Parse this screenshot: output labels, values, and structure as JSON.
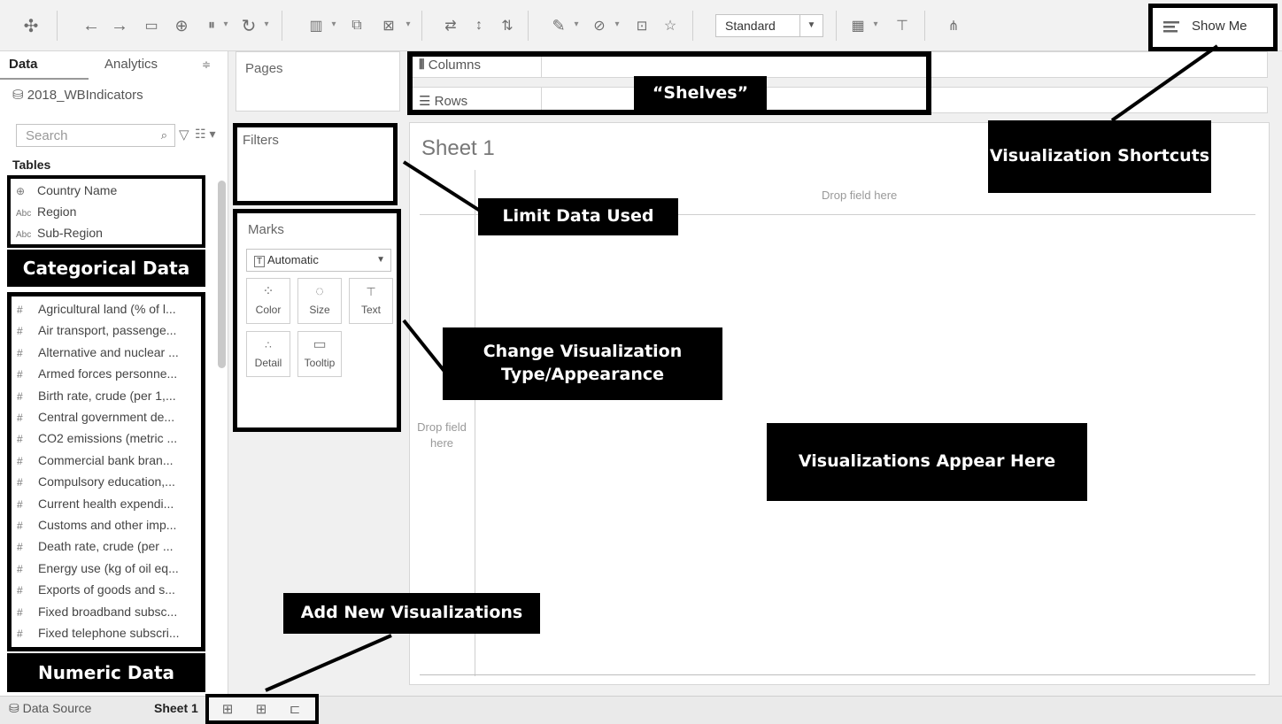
{
  "toolbar": {
    "mark_type_select": "Standard",
    "show_me_label": "Show Me",
    "icons": [
      "tableau-logo-icon",
      "back-icon",
      "forward-icon",
      "save-icon",
      "new-datasource-icon",
      "pause-updates-icon",
      "refresh-icon",
      "new-worksheet-icon",
      "duplicate-sheet-icon",
      "clear-sheet-icon",
      "swap-icon",
      "sort-ascending-icon",
      "sort-descending-icon",
      "highlight-icon",
      "group-icon",
      "labels-icon",
      "pin-icon",
      "fit-select",
      "show-cards-icon",
      "presentation-icon",
      "share-icon",
      "show-me-icon"
    ]
  },
  "data_pane": {
    "tabs": [
      "Data",
      "Analytics"
    ],
    "data_source": "2018_WBIndicators",
    "search_placeholder": "Search",
    "tables_label": "Tables",
    "categorical_fields": [
      {
        "type": "globe",
        "name": "Country Name"
      },
      {
        "type": "Abc",
        "name": "Region"
      },
      {
        "type": "Abc",
        "name": "Sub-Region"
      }
    ],
    "numeric_fields": [
      "Agricultural land (% of l...",
      "Air transport, passenge...",
      "Alternative and nuclear ...",
      "Armed forces personne...",
      "Birth rate, crude (per 1,...",
      "Central government de...",
      "CO2 emissions (metric ...",
      "Commercial bank bran...",
      "Compulsory education,...",
      "Current health expendi...",
      "Customs and other imp...",
      "Death rate, crude (per ...",
      "Energy use (kg of oil eq...",
      "Exports of goods and s...",
      "Fixed broadband subsc...",
      "Fixed telephone subscri..."
    ]
  },
  "cards": {
    "pages": "Pages",
    "filters": "Filters",
    "marks": "Marks",
    "marks_type": "Automatic",
    "mark_buttons": [
      "Color",
      "Size",
      "Text",
      "Detail",
      "Tooltip"
    ]
  },
  "shelves": {
    "columns": "Columns",
    "rows": "Rows"
  },
  "sheet": {
    "title": "Sheet 1",
    "drop_field_top": "Drop field here",
    "drop_field_left": "Drop field here"
  },
  "bottom": {
    "data_source_tab": "Data Source",
    "sheet_tab": "Sheet 1"
  },
  "annotations": {
    "shelves": "“Shelves”",
    "visualization_shortcuts": "Visualization Shortcuts",
    "limit_data": "Limit Data Used",
    "categorical": "Categorical Data",
    "change_viz": "Change Visualization Type/Appearance",
    "viz_appear": "Visualizations Appear Here",
    "add_new": "Add New Visualizations",
    "numeric": "Numeric Data"
  }
}
